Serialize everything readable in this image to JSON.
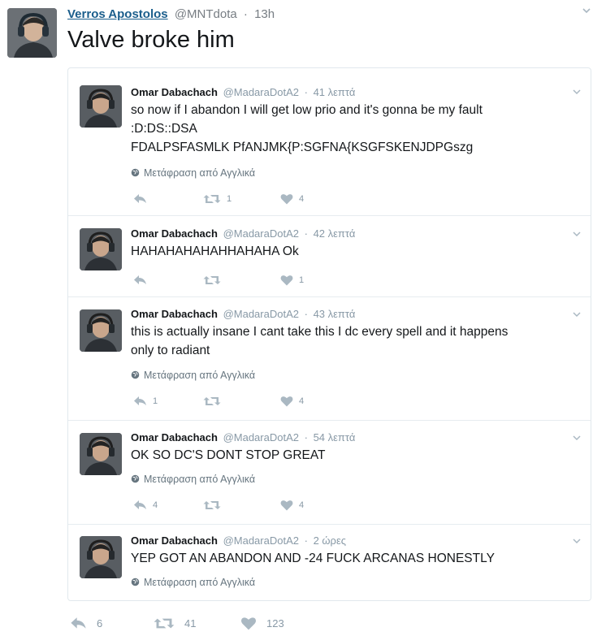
{
  "tweet": {
    "author_name": "Verros Apostolos",
    "author_handle": "@MNTdota",
    "dot": "·",
    "time": "13h",
    "text": "Valve broke him",
    "icons": {
      "menu": "chevron-down-icon"
    },
    "actions": {
      "reply_count": "6",
      "retweet_count": "41",
      "like_count": "123"
    }
  },
  "replies": [
    {
      "name": "Omar Dabachach",
      "handle": "@MadaraDotA2",
      "time": "41 λεπτά",
      "lines": [
        "so now if I abandon I will get low prio and it's gonna be my fault",
        ":D:DS::DSA",
        "FDALPSFASMLK PfANJMK{P:SGFNA{KSGFSKENJDPGszg"
      ],
      "translate": "Μετάφραση από Αγγλικά",
      "reply_count": "",
      "retweet_count": "1",
      "like_count": "4"
    },
    {
      "name": "Omar Dabachach",
      "handle": "@MadaraDotA2",
      "time": "42 λεπτά",
      "lines": [
        "HAHAHAHAHAHHAHAHA Ok"
      ],
      "translate": "",
      "reply_count": "",
      "retweet_count": "",
      "like_count": "1"
    },
    {
      "name": "Omar Dabachach",
      "handle": "@MadaraDotA2",
      "time": "43 λεπτά",
      "lines": [
        "this is actually insane I cant take this I dc every spell and it happens",
        "only to radiant"
      ],
      "translate": "Μετάφραση από Αγγλικά",
      "reply_count": "1",
      "retweet_count": "",
      "like_count": "4"
    },
    {
      "name": "Omar Dabachach",
      "handle": "@MadaraDotA2",
      "time": "54 λεπτά",
      "lines": [
        "OK SO DC'S DONT STOP GREAT"
      ],
      "translate": "Μετάφραση από Αγγλικά",
      "reply_count": "4",
      "retweet_count": "",
      "like_count": "4"
    },
    {
      "name": "Omar Dabachach",
      "handle": "@MadaraDotA2",
      "time": "2 ώρες",
      "lines": [
        "YEP GOT AN ABANDON AND -24 FUCK ARCANAS HONESTLY"
      ],
      "translate": "Μετάφραση από Αγγλικά",
      "reply_count": "",
      "retweet_count": "",
      "like_count": ""
    }
  ],
  "colors": {
    "link": "#1b5e8c",
    "muted": "#8899a6",
    "border": "#e1e8ed"
  }
}
